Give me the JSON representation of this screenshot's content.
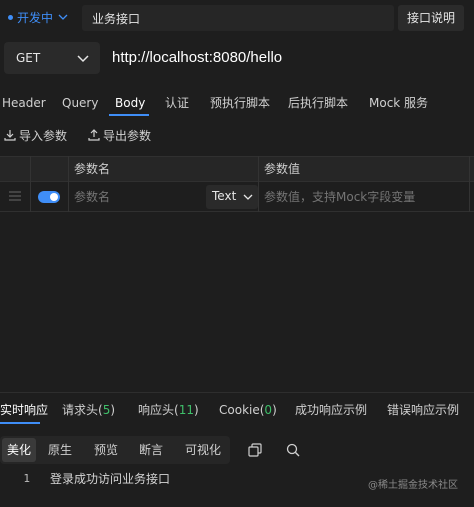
{
  "topbar": {
    "env_label": "开发中",
    "api_name": "业务接口",
    "doc_button": "接口说明"
  },
  "request": {
    "method": "GET",
    "url": "http://localhost:8080/hello"
  },
  "req_tabs": [
    {
      "label": "Header"
    },
    {
      "label": "Query"
    },
    {
      "label": "Body"
    },
    {
      "label": "认证"
    },
    {
      "label": "预执行脚本"
    },
    {
      "label": "后执行脚本"
    },
    {
      "label": "Mock 服务"
    }
  ],
  "actions": {
    "import": "导入参数",
    "export": "导出参数"
  },
  "params": {
    "header_name": "参数名",
    "header_value": "参数值",
    "name_placeholder": "参数名",
    "type": "Text",
    "value_placeholder": "参数值，支持Mock字段变量"
  },
  "resp_tabs": {
    "time": "实时响应",
    "req_headers": "请求头",
    "req_headers_count": "5",
    "resp_headers": "响应头",
    "resp_headers_count": "11",
    "cookie": "Cookie",
    "cookie_count": "0",
    "success_example": "成功响应示例",
    "error_example": "错误响应示例"
  },
  "format_tabs": [
    {
      "label": "美化"
    },
    {
      "label": "原生"
    },
    {
      "label": "预览"
    },
    {
      "label": "断言"
    },
    {
      "label": "可视化"
    }
  ],
  "response": {
    "line_number": "1",
    "text": "登录成功访问业务接口"
  },
  "watermark": "@稀土掘金技术社区",
  "colors": {
    "accent": "#3f8ef7",
    "count_green": "#3fbf6a",
    "background": "#1e1e1e"
  }
}
